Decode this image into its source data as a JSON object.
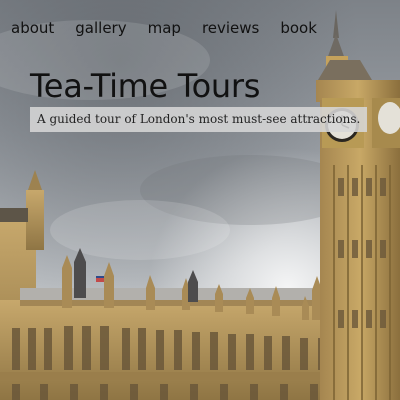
{
  "nav": {
    "items": [
      {
        "label": "about"
      },
      {
        "label": "gallery"
      },
      {
        "label": "map"
      },
      {
        "label": "reviews"
      },
      {
        "label": "book"
      }
    ]
  },
  "hero": {
    "title": "Tea-Time Tours",
    "tagline": "A guided tour of London's most must-see attractions."
  },
  "colors": {
    "sky": "#8e9399",
    "stone": "#b9995c",
    "text": "#111111",
    "tagline_bg": "#d6d6d6"
  }
}
